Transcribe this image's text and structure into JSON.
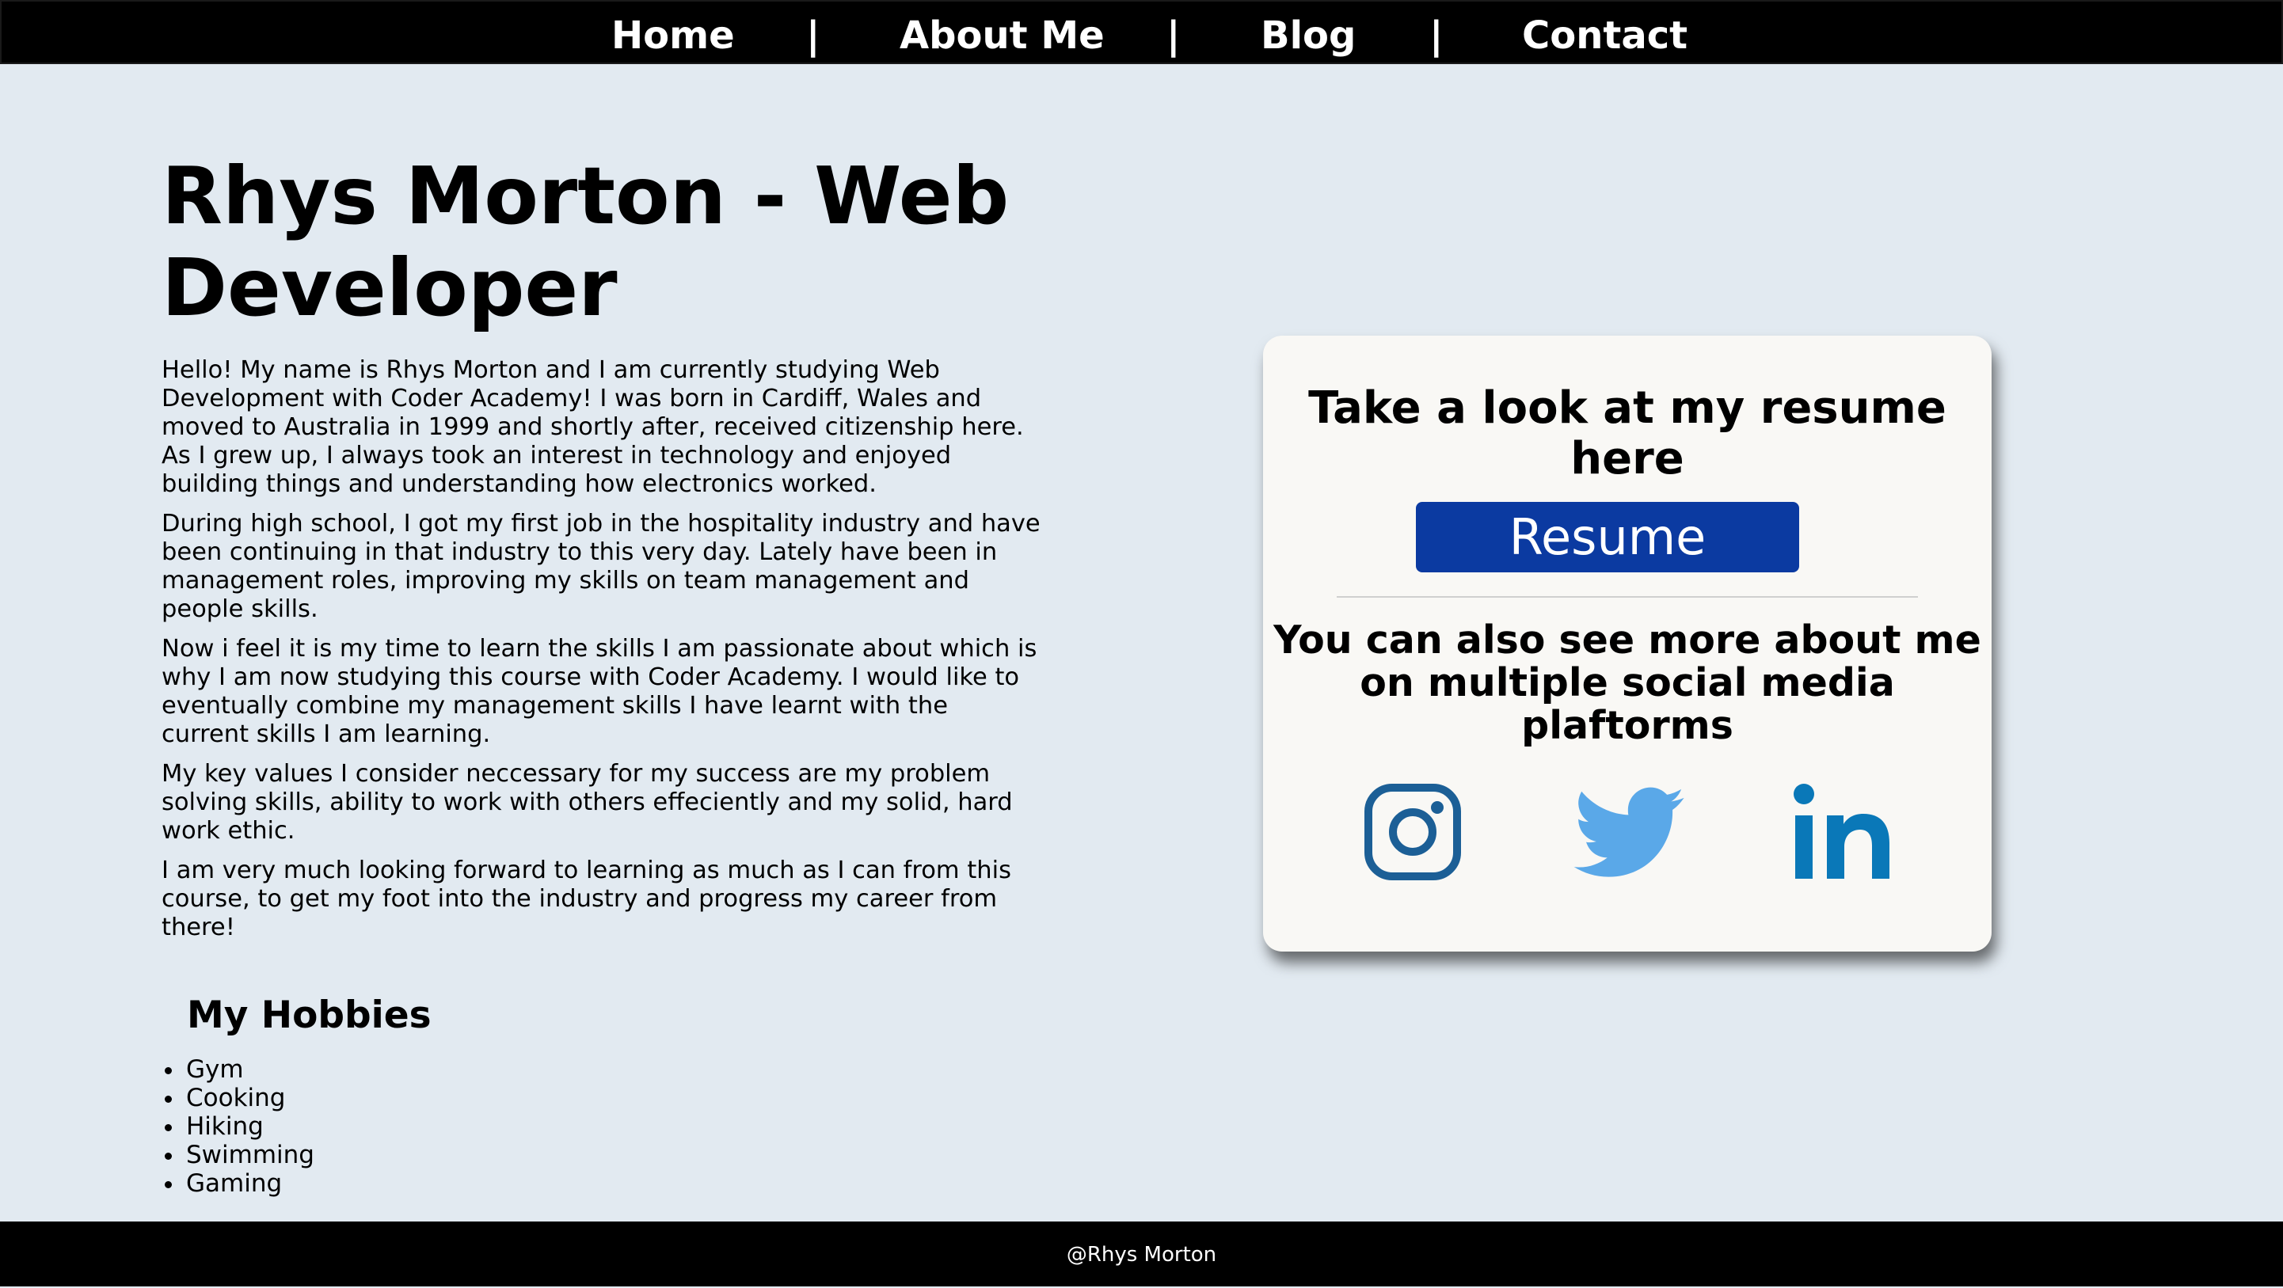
{
  "nav": {
    "items": [
      "Home",
      "About Me",
      "Blog",
      "Contact"
    ],
    "separator": "|"
  },
  "main": {
    "heading": "Rhys Morton - Web Developer",
    "paragraphs": [
      "Hello! My name is Rhys Morton and I am currently studying Web Development with Coder Academy! I was born in Cardiff, Wales and moved to Australia in 1999 and shortly after, received citizenship here. As I grew up, I always took an interest in technology and enjoyed building things and understanding how electronics worked.",
      "During high school, I got my first job in the hospitality industry and have been continuing in that industry to this very day. Lately have been in management roles, improving my skills on team management and people skills.",
      "Now i feel it is my time to learn the skills I am passionate about which is why I am now studying this course with Coder Academy. I would like to eventually combine my management skills I have learnt with the current skills I am learning.",
      "My key values I consider neccessary for my success are my problem solving skills, ability to work with others effeciently and my solid, hard work ethic.",
      "I am very much looking forward to learning as much as I can from this course, to get my foot into the industry and progress my career from there!"
    ]
  },
  "hobbies": {
    "title": "My Hobbies",
    "items": [
      "Gym",
      "Cooking",
      "Hiking",
      "Swimming",
      "Gaming"
    ]
  },
  "card": {
    "title": "Take a look at my resume here",
    "resume_button": "Resume",
    "social_text": "You can also see more about me on multiple social media plaftorms",
    "icons": [
      "instagram-icon",
      "twitter-icon",
      "linkedin-icon"
    ]
  },
  "footer": {
    "text": "@Rhys Morton"
  },
  "colors": {
    "nav_bg": "#000000",
    "page_bg": "#e2eaf1",
    "card_bg": "#f9f8f5",
    "resume_button": "#0b3aa1",
    "instagram": "#1c5f96",
    "twitter": "#5aa8e8",
    "linkedin": "#0a78b8"
  }
}
